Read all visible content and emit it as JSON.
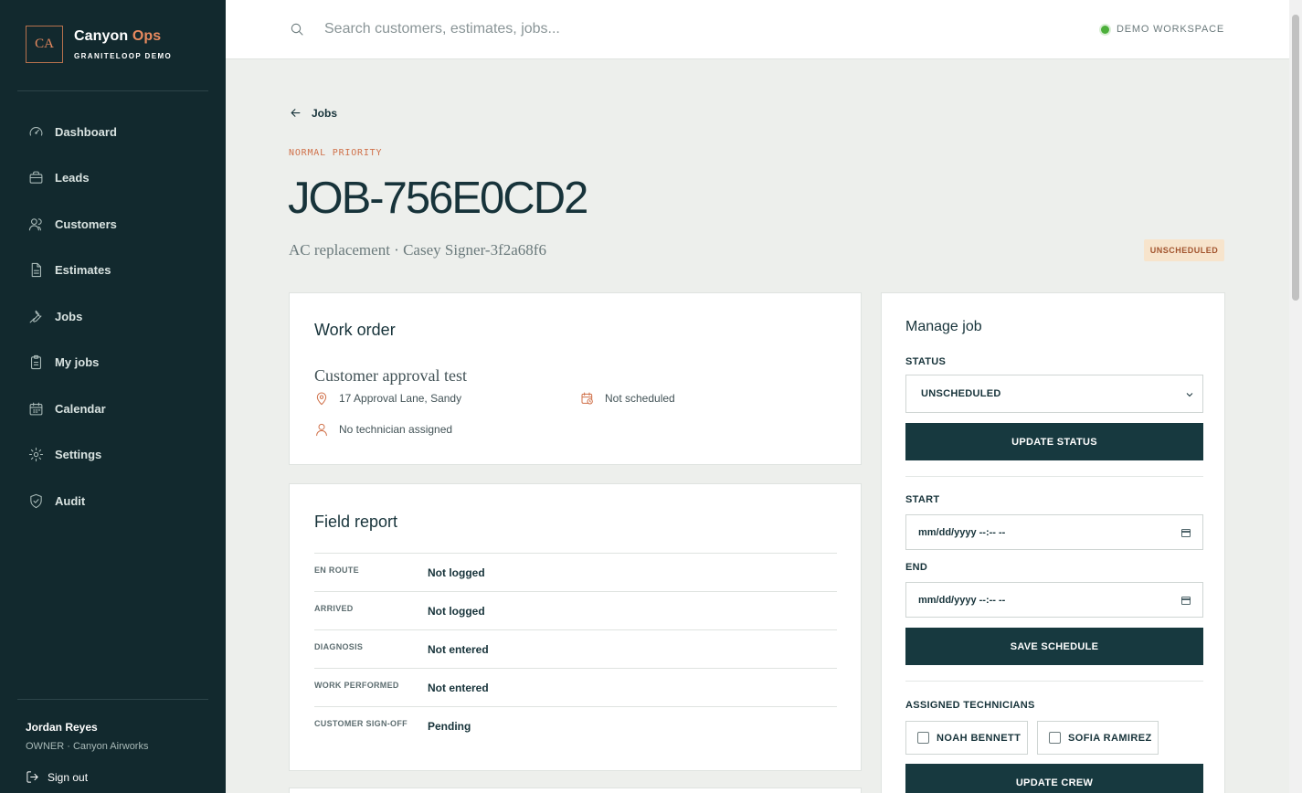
{
  "brand": {
    "logo": "CA",
    "name_main": "Canyon",
    "name_accent": "Ops",
    "subtitle": "GRANITELOOP DEMO"
  },
  "nav": [
    {
      "label": "Dashboard",
      "icon": "gauge-icon"
    },
    {
      "label": "Leads",
      "icon": "briefcase-icon"
    },
    {
      "label": "Customers",
      "icon": "users-icon"
    },
    {
      "label": "Estimates",
      "icon": "document-icon"
    },
    {
      "label": "Jobs",
      "icon": "wrench-icon"
    },
    {
      "label": "My jobs",
      "icon": "clipboard-icon"
    },
    {
      "label": "Calendar",
      "icon": "calendar-icon"
    },
    {
      "label": "Settings",
      "icon": "gear-icon"
    },
    {
      "label": "Audit",
      "icon": "shield-check-icon"
    }
  ],
  "user": {
    "name": "Jordan Reyes",
    "role": "OWNER · Canyon Airworks",
    "signout": "Sign out"
  },
  "topbar": {
    "search_placeholder": "Search customers, estimates, jobs...",
    "workspace": "DEMO WORKSPACE",
    "workspace_dot_color": "#4caf3a"
  },
  "header": {
    "back_label": "Jobs",
    "priority": "NORMAL PRIORITY",
    "title": "JOB-756E0CD2",
    "subtitle": "AC replacement · Casey Signer-3f2a68f6",
    "status_badge": "UNSCHEDULED"
  },
  "work_order": {
    "title": "Work order",
    "name": "Customer approval test",
    "address": "17 Approval Lane, Sandy",
    "schedule": "Not scheduled",
    "technician": "No technician assigned"
  },
  "field_report": {
    "title": "Field report",
    "rows": [
      {
        "label": "EN ROUTE",
        "value": "Not logged"
      },
      {
        "label": "ARRIVED",
        "value": "Not logged"
      },
      {
        "label": "DIAGNOSIS",
        "value": "Not entered"
      },
      {
        "label": "WORK PERFORMED",
        "value": "Not entered"
      },
      {
        "label": "CUSTOMER SIGN-OFF",
        "value": "Pending"
      }
    ]
  },
  "manage_job": {
    "title": "Manage job",
    "status_label": "STATUS",
    "status_value": "UNSCHEDULED",
    "update_status": "UPDATE STATUS",
    "start_label": "START",
    "start_value": "mm/dd/yyyy --:-- --",
    "end_label": "END",
    "end_value": "mm/dd/yyyy --:-- --",
    "save_schedule": "SAVE SCHEDULE",
    "technicians_label": "ASSIGNED TECHNICIANS",
    "technicians": [
      "NOAH BENNETT",
      "SOFIA RAMIREZ"
    ],
    "update_crew": "UPDATE CREW"
  },
  "colors": {
    "sidebar": "#12292e",
    "accent": "#e88a5f",
    "primary_button": "#17393f",
    "badge_bg": "#f7e4cc"
  }
}
